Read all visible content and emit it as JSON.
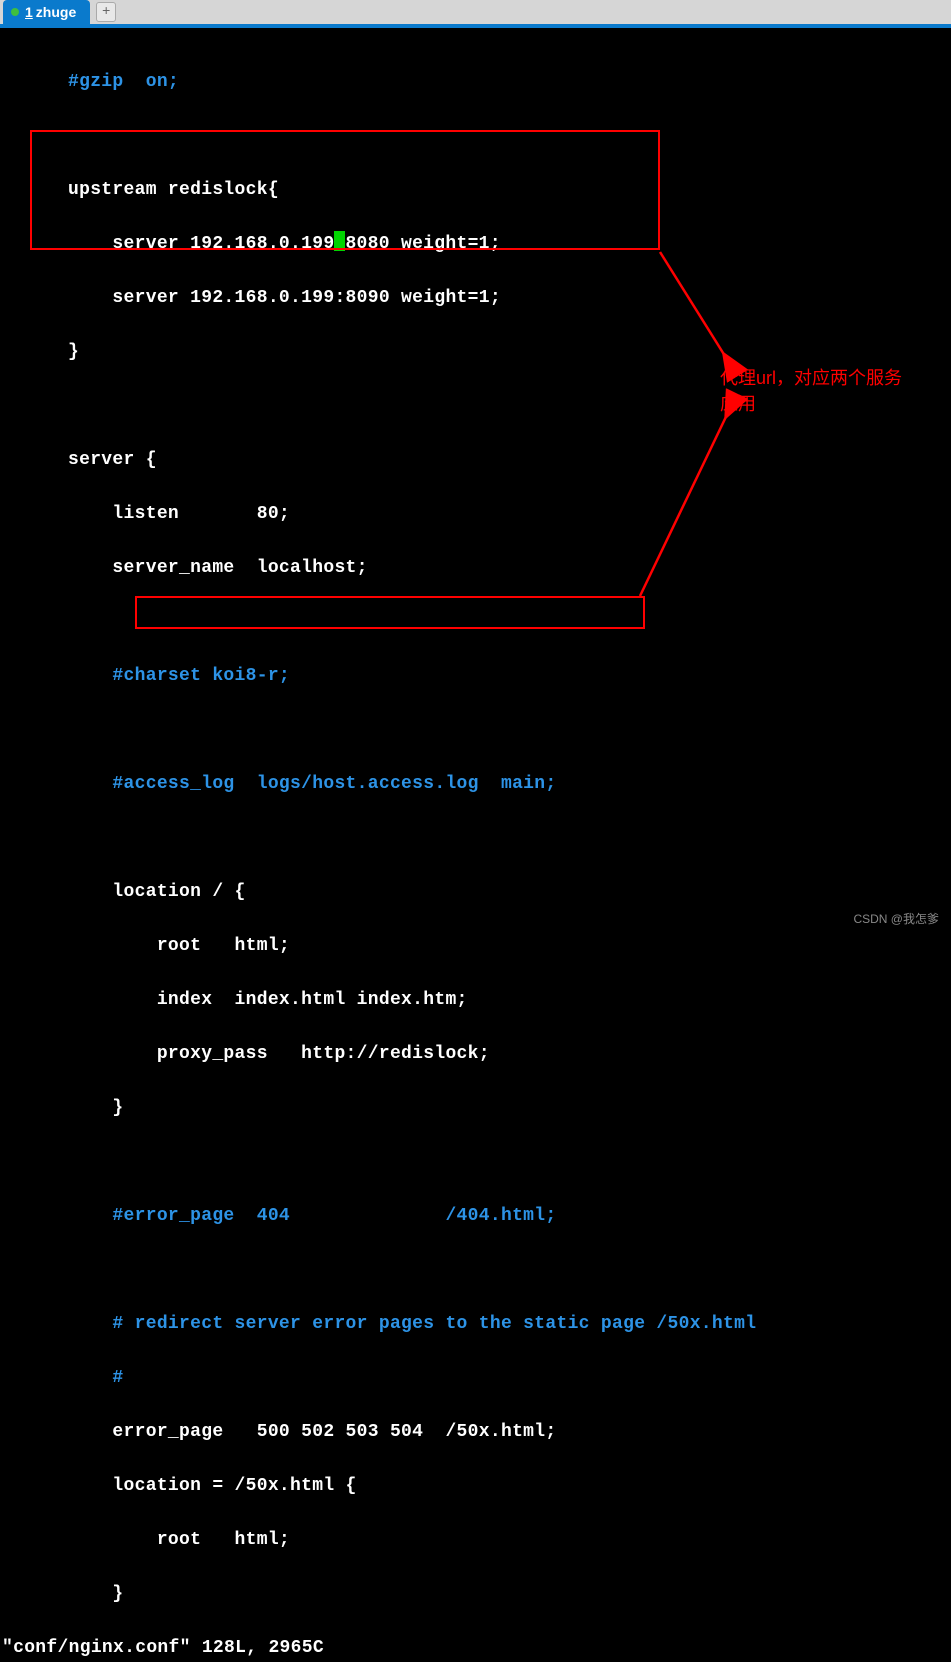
{
  "tab": {
    "index": "1",
    "name": "zhuge"
  },
  "code": {
    "l1": "#gzip  on;",
    "l2": "upstream redislock{",
    "l3a": "    server 192.168.0.199",
    "l3b": "8080 weight=1;",
    "l4": "    server 192.168.0.199:8090 weight=1;",
    "l5": "}",
    "l6": "server {",
    "l7": "    listen       80;",
    "l8": "    server_name  localhost;",
    "l9": "    #charset koi8-r;",
    "l10": "    #access_log  logs/host.access.log  main;",
    "l11": "    location / {",
    "l12": "        root   html;",
    "l13": "        index  index.html index.htm;",
    "l14": "        proxy_pass   http://redislock;",
    "l15": "    }",
    "l16": "    #error_page  404              /404.html;",
    "l17": "    # redirect server error pages to the static page /50x.html",
    "l18": "    #",
    "l19": "    error_page   500 502 503 504  /50x.html;",
    "l20": "    location = /50x.html {",
    "l21": "        root   html;",
    "l22": "    }"
  },
  "status": "\"conf/nginx.conf\" 128L, 2965C",
  "annotation": {
    "line1": "代理url，对应两个服务",
    "line2": "应用"
  },
  "watermark": "CSDN @我怎爹"
}
